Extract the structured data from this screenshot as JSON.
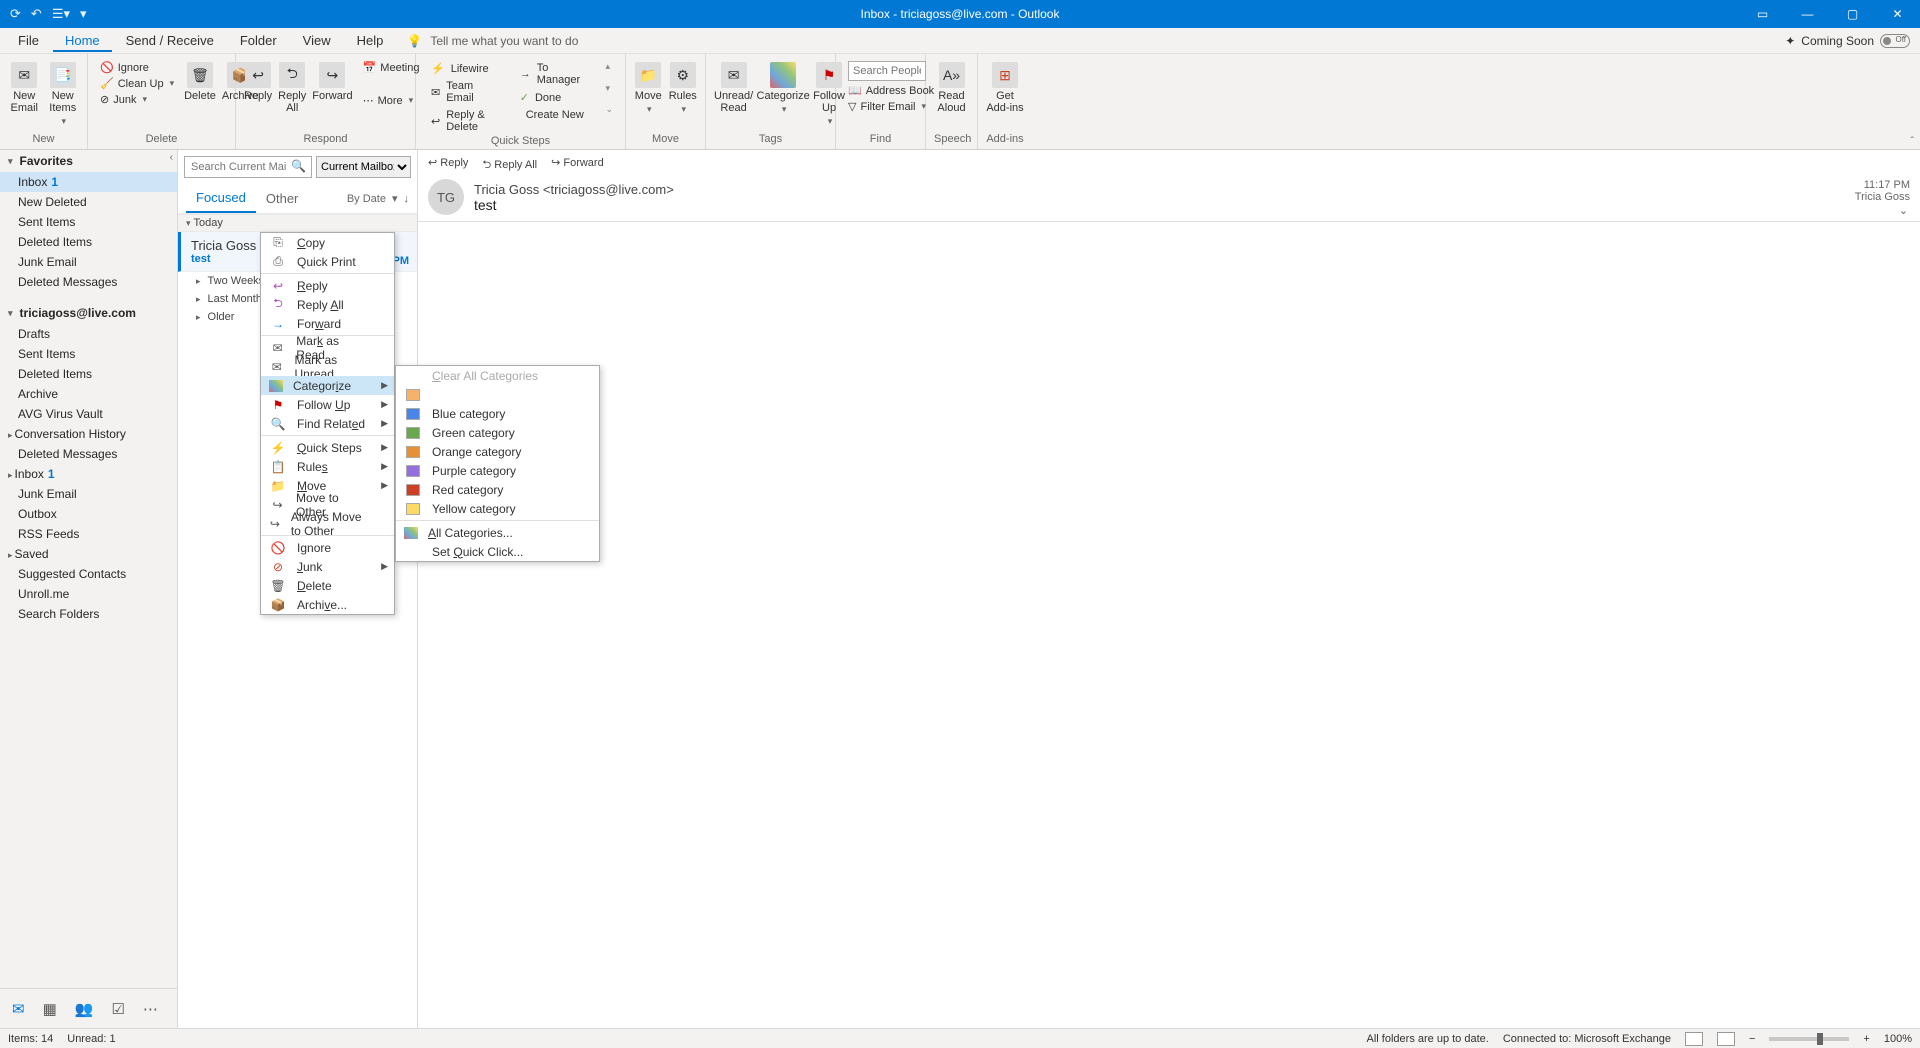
{
  "titlebar": {
    "title": "Inbox - triciagoss@live.com  -  Outlook"
  },
  "menutabs": {
    "file": "File",
    "home": "Home",
    "sendreceive": "Send / Receive",
    "folder": "Folder",
    "view": "View",
    "help": "Help",
    "tell": "Tell me what you want to do",
    "coming": "Coming Soon",
    "toggle": "Off"
  },
  "ribbon": {
    "new": {
      "label": "New",
      "newemail": "New\nEmail",
      "newitems": "New\nItems"
    },
    "delete": {
      "label": "Delete",
      "ignore": "Ignore",
      "cleanup": "Clean Up",
      "junk": "Junk",
      "delete": "Delete",
      "archive": "Archive"
    },
    "respond": {
      "label": "Respond",
      "reply": "Reply",
      "replyall": "Reply\nAll",
      "forward": "Forward",
      "meeting": "Meeting",
      "more": "More"
    },
    "quicksteps": {
      "label": "Quick Steps",
      "items": [
        "Lifewire",
        "Team Email",
        "Reply & Delete",
        "To Manager",
        "Done",
        "Create New"
      ]
    },
    "move": {
      "label": "Move",
      "move": "Move",
      "rules": "Rules"
    },
    "tags": {
      "label": "Tags",
      "unread": "Unread/\nRead",
      "categorize": "Categorize",
      "followup": "Follow\nUp"
    },
    "find": {
      "label": "Find",
      "search_ph": "Search People",
      "address": "Address Book",
      "filter": "Filter Email"
    },
    "speech": {
      "label": "Speech",
      "read": "Read\nAloud"
    },
    "addins": {
      "label": "Add-ins",
      "get": "Get\nAdd-ins"
    }
  },
  "nav": {
    "favorites": "Favorites",
    "fav_items": [
      {
        "t": "Inbox",
        "c": "1",
        "sel": true
      },
      {
        "t": "New Deleted"
      },
      {
        "t": "Sent Items"
      },
      {
        "t": "Deleted Items"
      },
      {
        "t": "Junk Email"
      },
      {
        "t": "Deleted Messages"
      }
    ],
    "account": "triciagoss@live.com",
    "acct_items": [
      {
        "t": "Drafts"
      },
      {
        "t": "Sent Items"
      },
      {
        "t": "Deleted Items"
      },
      {
        "t": "Archive"
      },
      {
        "t": "AVG Virus Vault"
      },
      {
        "t": "Conversation History",
        "exp": true
      },
      {
        "t": "Deleted Messages"
      },
      {
        "t": "Inbox",
        "c": "1",
        "exp": true
      },
      {
        "t": "Junk Email"
      },
      {
        "t": "Outbox"
      },
      {
        "t": "RSS Feeds"
      },
      {
        "t": "Saved",
        "exp": true
      },
      {
        "t": "Suggested Contacts"
      },
      {
        "t": "Unroll.me"
      },
      {
        "t": "Search Folders"
      }
    ]
  },
  "list": {
    "search_ph": "Search Current Mailbox",
    "scope": "Current Mailbox",
    "tabs": {
      "focused": "Focused",
      "other": "Other",
      "sort": "By Date"
    },
    "groups": {
      "today": "Today",
      "twoweeks": "Two Weeks Ago",
      "lastmonth": "Last Month",
      "older": "Older"
    },
    "msg": {
      "from": "Tricia Goss",
      "subj": "test",
      "time": "11:17 PM"
    }
  },
  "read": {
    "reply": "Reply",
    "replyall": "Reply All",
    "forward": "Forward",
    "initials": "TG",
    "from": "Tricia Goss <triciagoss@live.com>",
    "to": "Tricia Goss",
    "subject": "test",
    "time": "11:17 PM"
  },
  "ctx": {
    "copy": "Copy",
    "quickprint": "Quick Print",
    "reply": "Reply",
    "replyall": "Reply All",
    "forward": "Forward",
    "markread": "Mark as Read",
    "markunread": "Mark as Unread",
    "categorize": "Categorize",
    "followup": "Follow Up",
    "findrelated": "Find Related",
    "quicksteps": "Quick Steps",
    "rules": "Rules",
    "move": "Move",
    "movetoother": "Move to Other",
    "alwaysmove": "Always Move to Other",
    "ignore": "Ignore",
    "junk": "Junk",
    "delete": "Delete",
    "archive": "Archive..."
  },
  "catmenu": {
    "clear": "Clear All Categories",
    "items": [
      {
        "t": "Blue category",
        "c": "#4a86e8"
      },
      {
        "t": "Green category",
        "c": "#6aa84f"
      },
      {
        "t": "Orange category",
        "c": "#e69138"
      },
      {
        "t": "Purple category",
        "c": "#9370db"
      },
      {
        "t": "Red category",
        "c": "#cc4125"
      },
      {
        "t": "Yellow category",
        "c": "#ffd966"
      }
    ],
    "all": "All Categories...",
    "quick": "Set Quick Click..."
  },
  "status": {
    "items": "Items: 14",
    "unread": "Unread: 1",
    "uptodate": "All folders are up to date.",
    "connected": "Connected to: Microsoft Exchange",
    "zoom": "100%"
  }
}
